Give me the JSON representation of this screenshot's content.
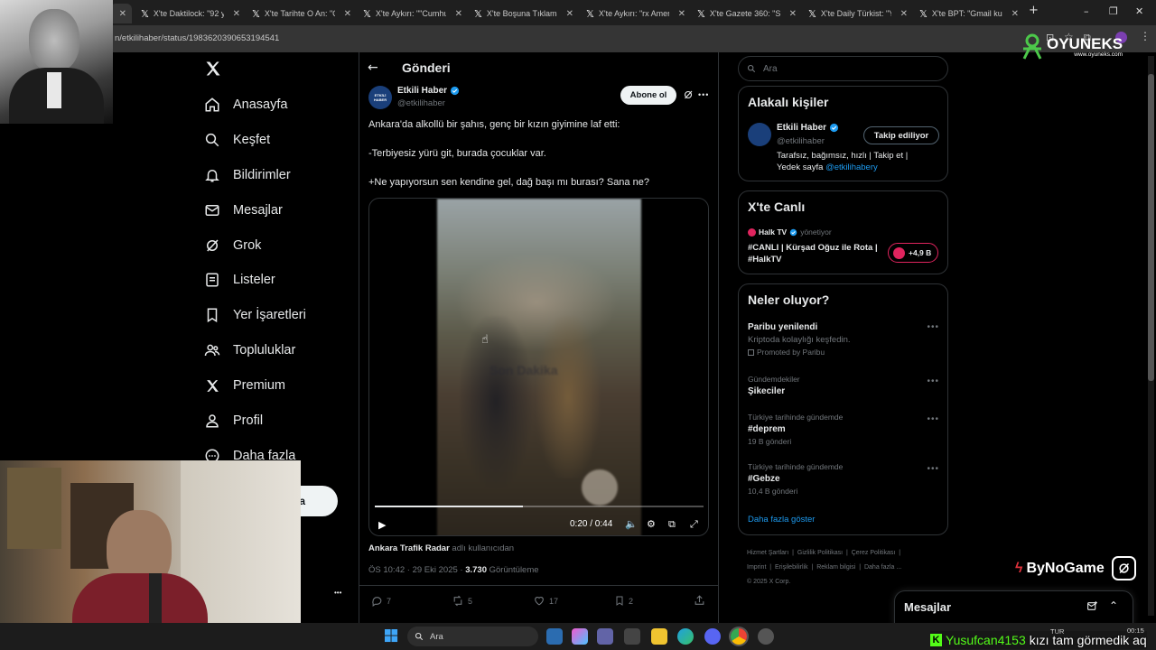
{
  "browser": {
    "tabs": [
      {
        "title": "X'te Daktilock: \"92 ya"
      },
      {
        "title": "X'te Tarihte O An: \"Cu"
      },
      {
        "title": "X'te Aykırı: \"\"Cumhur"
      },
      {
        "title": "X'te Boşuna Tıklama:"
      },
      {
        "title": "X'te Aykırı: \"rx Ameri"
      },
      {
        "title": "X'te Gazete 360: \"Sın"
      },
      {
        "title": "X'te Daily Türkist: \"Yo"
      },
      {
        "title": "X'te BPT: \"Gmail kulla"
      }
    ],
    "url": "n/etkilihaber/status/1983620390653194541",
    "new_tab": "+",
    "win_min": "–",
    "win_max": "❐",
    "win_close": "✕",
    "tab_close": "✕"
  },
  "nav": {
    "logo": "X",
    "items": [
      {
        "label": "Anasayfa",
        "icon": "home-icon"
      },
      {
        "label": "Keşfet",
        "icon": "search-icon"
      },
      {
        "label": "Bildirimler",
        "icon": "bell-icon"
      },
      {
        "label": "Mesajlar",
        "icon": "mail-icon"
      },
      {
        "label": "Grok",
        "icon": "grok-icon"
      },
      {
        "label": "Listeler",
        "icon": "list-icon"
      },
      {
        "label": "Yer İşaretleri",
        "icon": "bookmark-icon"
      },
      {
        "label": "Topluluklar",
        "icon": "people-icon"
      },
      {
        "label": "Premium",
        "icon": "x-icon"
      },
      {
        "label": "Profil",
        "icon": "user-icon"
      },
      {
        "label": "Daha fazla",
        "icon": "more-icon"
      }
    ],
    "post_button_partial": "a",
    "more_dots": "•••"
  },
  "post": {
    "header_title": "Gönderi",
    "author_name": "Etkili Haber",
    "author_handle": "@etkilihaber",
    "avatar_text": "ETKİLİ HABER",
    "subscribe_label": "Abone ol",
    "text_lines": [
      "Ankara'da alkollü bir şahıs, genç bir kızın giyimine laf etti:",
      "-Terbiyesiz yürü git, burada çocuklar var.",
      "+Ne yapıyorsun sen kendine gel, dağ başı mı burası? Sana ne?"
    ],
    "video": {
      "watermark": "Son Dakika",
      "time": "0:20 / 0:44",
      "progress": 0.45
    },
    "source_name": "Ankara Trafik Radar",
    "source_suffix": "adlı kullanıcıdan",
    "timestamp": "ÖS 10:42 · 29 Eki 2025 ·",
    "views": "3.730",
    "views_label": "Görüntüleme",
    "actions": {
      "replies": "7",
      "reposts": "5",
      "likes": "17",
      "bookmarks": "2"
    }
  },
  "sidebar": {
    "search_placeholder": "Ara",
    "related": {
      "title": "Alakalı kişiler",
      "name": "Etkili Haber",
      "handle": "@etkilihaber",
      "follow_label": "Takip ediliyor",
      "bio": "Tarafsız, bağımsız, hızlı | Takip et | Yedek sayfa",
      "bio_link": "@etkilihabery"
    },
    "live": {
      "title": "X'te Canlı",
      "host": "Halk TV",
      "host_role": "yönetiyor",
      "stream_title": "#CANLI | Kürşad Oğuz ile Rota | #HalkTV",
      "listeners": "+4,9 B"
    },
    "trends": {
      "title": "Neler oluyor?",
      "items": [
        {
          "meta": "",
          "title": "Paribu yenilendi",
          "sub": "Kriptoda kolaylığı keşfedin.",
          "extra": "Promoted by Paribu"
        },
        {
          "meta": "Gündemdekiler",
          "title": "Şikeciler",
          "sub": "",
          "extra": ""
        },
        {
          "meta": "Türkiye tarihinde gündemde",
          "title": "#deprem",
          "sub": "19 B gönderi",
          "extra": ""
        },
        {
          "meta": "Türkiye tarihinde gündemde",
          "title": "#Gebze",
          "sub": "10,4 B gönderi",
          "extra": ""
        }
      ],
      "show_more": "Daha fazla göster"
    },
    "footer": {
      "links": [
        "Hizmet Şartları",
        "Gizlilik Politikası",
        "Çerez Politikası",
        "Imprint",
        "Erişilebilirlik",
        "Reklam bilgisi",
        "Daha fazla ..."
      ],
      "copyright": "© 2025 X Corp."
    }
  },
  "messages_bar": {
    "label": "Mesajlar"
  },
  "overlays": {
    "brand": "OYUNEKS",
    "brand_url": "www.oyuneks.com",
    "bynogame": "ByNoGame",
    "chat_user": "Yusufcan4153",
    "chat_text": "kızı tam görmedik aq"
  },
  "taskbar": {
    "search": "Ara",
    "time": "00:15",
    "lang": "TUR"
  }
}
